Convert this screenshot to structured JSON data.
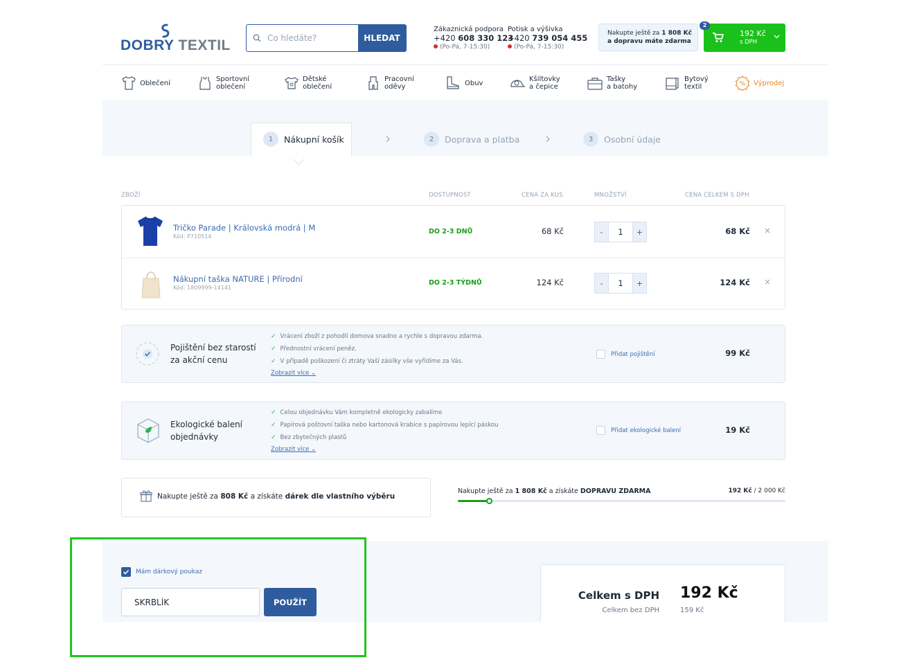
{
  "header": {
    "logo": {
      "part1": "DOBRY",
      "part2": "TEXTIL"
    },
    "search": {
      "placeholder": "Co hledáte?",
      "button": "HLEDAT"
    },
    "support": {
      "label": "Zákaznická podpora",
      "phone_prefix": "+420",
      "phone_main": "608 330 123",
      "hours": "(Po-Pá, 7-15:30)"
    },
    "print": {
      "label": "Potisk a výšivka",
      "phone_prefix": "+420",
      "phone_main": "739 054 455",
      "hours": "(Po-Pá, 7-15:30)"
    },
    "free_shipping": {
      "line1_pre": "Nakupte ještě za",
      "line1_amt": "1 808 Kč",
      "line2": "a dopravu máte zdarma"
    },
    "cart": {
      "count": "2",
      "amount": "192 Kč",
      "tax": "s DPH"
    }
  },
  "nav": [
    {
      "line1": "Oblečení",
      "line2": ""
    },
    {
      "line1": "Sportovní",
      "line2": "oblečení"
    },
    {
      "line1": "Dětské",
      "line2": "oblečení"
    },
    {
      "line1": "Pracovní",
      "line2": "oděvy"
    },
    {
      "line1": "Obuv",
      "line2": ""
    },
    {
      "line1": "Kšiltovky",
      "line2": "a čepice"
    },
    {
      "line1": "Tašky",
      "line2": "a batohy"
    },
    {
      "line1": "Bytový",
      "line2": "textil"
    },
    {
      "line1": "Výprodej",
      "line2": ""
    }
  ],
  "steps": [
    {
      "num": "1",
      "label": "Nákupní košík"
    },
    {
      "num": "2",
      "label": "Doprava a platba"
    },
    {
      "num": "3",
      "label": "Osobní údaje"
    }
  ],
  "table": {
    "headers": {
      "product": "ZBOŽÍ",
      "availability": "DOSTUPNOST",
      "unit_price": "CENA ZA KUS",
      "quantity": "MNOŽSTVÍ",
      "total": "CENA CELKEM S DPH"
    },
    "items": [
      {
        "name": "Tričko Parade | Královská modrá | M",
        "code": "Kód: P710514",
        "availability": "DO 2-3 DNŮ",
        "unit_price": "68 Kč",
        "qty": "1",
        "total": "68 Kč"
      },
      {
        "name": "Nákupní taška NATURE | Přírodní",
        "code": "Kód: 1809999-14141",
        "availability": "DO 2-3 TÝDNŮ",
        "unit_price": "124 Kč",
        "qty": "1",
        "total": "124 Kč"
      }
    ],
    "qty_minus": "-",
    "qty_plus": "+",
    "remove": "×"
  },
  "insurance": {
    "title1": "Pojištění bez starostí",
    "title2": "za akční cenu",
    "benefits": [
      "Vrácení zboží z pohodlí domova snadno a rychle s dopravou zdarma.",
      "Přednostní vrácení peněz.",
      "V případě poškození či ztráty Vaší zásilky vše vyřídíme za Vás."
    ],
    "more": "Zobrazit více",
    "add_label": "Přidat pojištění",
    "price": "99 Kč"
  },
  "eco": {
    "title1": "Ekologické balení",
    "title2": "objednávky",
    "benefits": [
      "Celou objednávku Vám kompletně ekologicky zabalíme",
      "Papírová poštovní taška nebo kartonová krabice s papírovou lepící páskou",
      "Bez zbytečných plastů"
    ],
    "more": "Zobrazit více",
    "add_label": "Přidat ekologické balení",
    "price": "19 Kč"
  },
  "gift": {
    "pre": "Nakupte ještě za",
    "amt": "808 Kč",
    "mid": "a získáte",
    "bold": "dárek dle vlastního výběru"
  },
  "free_ship_bar": {
    "pre": "Nakupte ještě za",
    "amt": "1 808 Kč",
    "mid": "a získáte",
    "bold": "DOPRAVU ZDARMA",
    "current": "192 Kč",
    "goal": "2 000 Kč",
    "progress": 0.096
  },
  "voucher": {
    "checkbox_label": "Mám dárkový poukaz",
    "code": "SKRBLÍK",
    "button": "POUŽÍT"
  },
  "summary": {
    "total_label": "Celkem s DPH",
    "total_value": "192 Kč",
    "net_label": "Celkem bez DPH",
    "net_value": "159 Kč"
  },
  "colors": {
    "brand": "#2e5c9e",
    "cta": "#1bc11b",
    "link": "#3b6bb0",
    "available": "#1a9e1a",
    "sale": "#e08a2e",
    "highlight": "#1fc41f"
  }
}
